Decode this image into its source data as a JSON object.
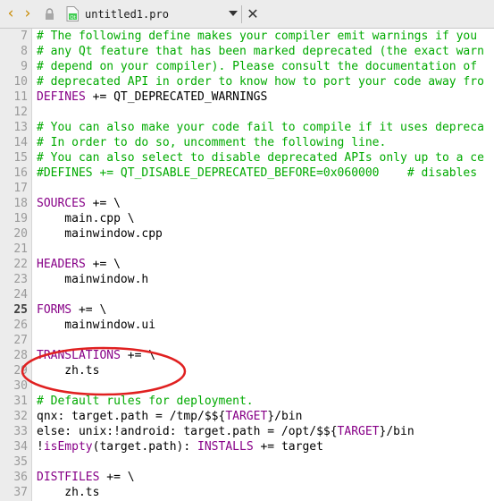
{
  "tab": {
    "prev_glyph": "‹",
    "next_glyph": "›",
    "filename": "untitled1.pro",
    "close_glyph": "✕"
  },
  "colors": {
    "comment": "#00aa00",
    "variable": "#870087",
    "annotation": "#e02020",
    "nav_arrow": "#c98a00"
  },
  "lines": [
    {
      "num": "7",
      "segs": [
        {
          "t": "# The following define makes your compiler emit warnings if you",
          "c": "comment"
        }
      ]
    },
    {
      "num": "8",
      "segs": [
        {
          "t": "# any Qt feature that has been marked deprecated (the exact warn",
          "c": "comment"
        }
      ]
    },
    {
      "num": "9",
      "segs": [
        {
          "t": "# depend on your compiler). Please consult the documentation of",
          "c": "comment"
        }
      ]
    },
    {
      "num": "10",
      "segs": [
        {
          "t": "# deprecated API in order to know how to port your code away fro",
          "c": "comment"
        }
      ]
    },
    {
      "num": "11",
      "segs": [
        {
          "t": "DEFINES",
          "c": "var"
        },
        {
          "t": " += QT_DEPRECATED_WARNINGS",
          "c": "plain"
        }
      ]
    },
    {
      "num": "12",
      "segs": []
    },
    {
      "num": "13",
      "segs": [
        {
          "t": "# You can also make your code fail to compile if it uses depreca",
          "c": "comment"
        }
      ]
    },
    {
      "num": "14",
      "segs": [
        {
          "t": "# In order to do so, uncomment the following line.",
          "c": "comment"
        }
      ]
    },
    {
      "num": "15",
      "segs": [
        {
          "t": "# You can also select to disable deprecated APIs only up to a ce",
          "c": "comment"
        }
      ]
    },
    {
      "num": "16",
      "segs": [
        {
          "t": "#DEFINES += QT_DISABLE_DEPRECATED_BEFORE=0x060000    # disables",
          "c": "comment"
        }
      ]
    },
    {
      "num": "17",
      "segs": []
    },
    {
      "num": "18",
      "segs": [
        {
          "t": "SOURCES",
          "c": "var"
        },
        {
          "t": " += \\",
          "c": "plain"
        }
      ]
    },
    {
      "num": "19",
      "segs": [
        {
          "t": "    main.cpp \\",
          "c": "plain"
        }
      ]
    },
    {
      "num": "20",
      "segs": [
        {
          "t": "    mainwindow.cpp",
          "c": "plain"
        }
      ]
    },
    {
      "num": "21",
      "segs": []
    },
    {
      "num": "22",
      "segs": [
        {
          "t": "HEADERS",
          "c": "var"
        },
        {
          "t": " += \\",
          "c": "plain"
        }
      ]
    },
    {
      "num": "23",
      "segs": [
        {
          "t": "    mainwindow.h",
          "c": "plain"
        }
      ]
    },
    {
      "num": "24",
      "segs": []
    },
    {
      "num": "25",
      "cur": true,
      "segs": [
        {
          "t": "FORMS",
          "c": "var"
        },
        {
          "t": " += \\",
          "c": "plain"
        }
      ]
    },
    {
      "num": "26",
      "segs": [
        {
          "t": "    mainwindow.ui",
          "c": "plain"
        }
      ]
    },
    {
      "num": "27",
      "segs": []
    },
    {
      "num": "28",
      "segs": [
        {
          "t": "TRANSLATIONS",
          "c": "var"
        },
        {
          "t": " += \\",
          "c": "plain"
        }
      ]
    },
    {
      "num": "29",
      "segs": [
        {
          "t": "    zh.ts",
          "c": "plain"
        }
      ]
    },
    {
      "num": "30",
      "segs": []
    },
    {
      "num": "31",
      "segs": [
        {
          "t": "# Default rules for deployment.",
          "c": "comment"
        }
      ]
    },
    {
      "num": "32",
      "segs": [
        {
          "t": "qnx: target.path = /tmp/$${",
          "c": "plain"
        },
        {
          "t": "TARGET",
          "c": "var"
        },
        {
          "t": "}/bin",
          "c": "plain"
        }
      ]
    },
    {
      "num": "33",
      "segs": [
        {
          "t": "else: unix:!android: target.path = /opt/$${",
          "c": "plain"
        },
        {
          "t": "TARGET",
          "c": "var"
        },
        {
          "t": "}/bin",
          "c": "plain"
        }
      ]
    },
    {
      "num": "34",
      "segs": [
        {
          "t": "!",
          "c": "plain"
        },
        {
          "t": "isEmpty",
          "c": "fn"
        },
        {
          "t": "(target.path): ",
          "c": "plain"
        },
        {
          "t": "INSTALLS",
          "c": "var"
        },
        {
          "t": " += target",
          "c": "plain"
        }
      ]
    },
    {
      "num": "35",
      "segs": []
    },
    {
      "num": "36",
      "segs": [
        {
          "t": "DISTFILES",
          "c": "var"
        },
        {
          "t": " += \\",
          "c": "plain"
        }
      ]
    },
    {
      "num": "37",
      "segs": [
        {
          "t": "    zh.ts",
          "c": "plain"
        }
      ]
    }
  ]
}
